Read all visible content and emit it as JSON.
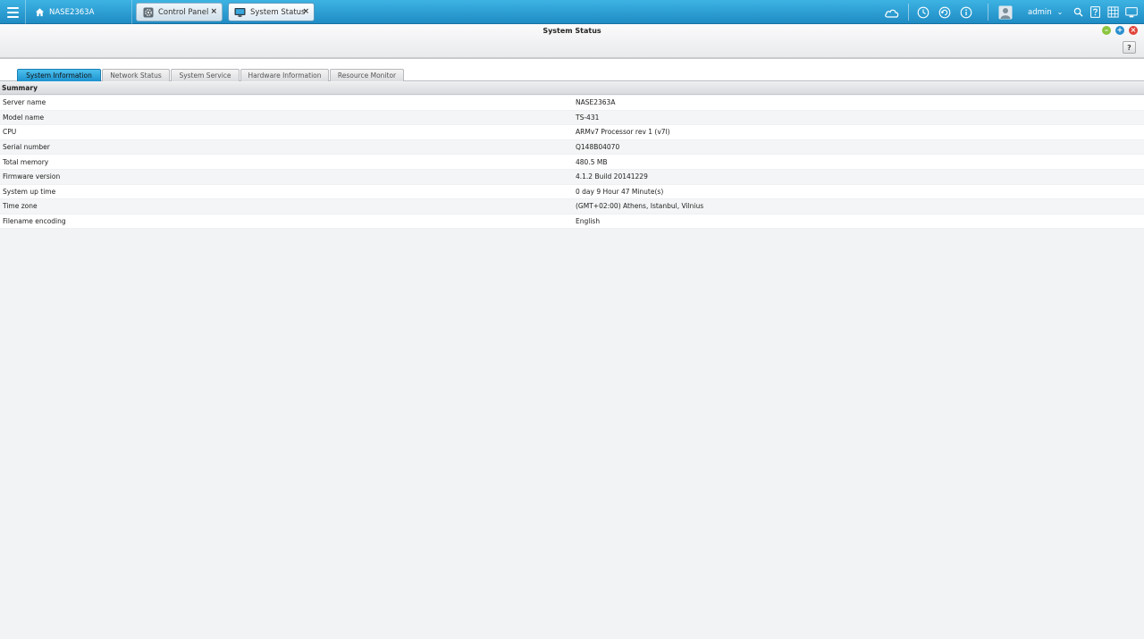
{
  "taskbar": {
    "home_label": "NASE2363A",
    "tabs": [
      {
        "label": "Control Panel",
        "close": "×"
      },
      {
        "label": "System Status",
        "close": "×"
      }
    ],
    "user": {
      "name": "admin",
      "caret": "⌄"
    }
  },
  "window": {
    "title": "System Status",
    "help": "?",
    "controls": {
      "minimize": "–",
      "maximize": "+",
      "close": "×"
    }
  },
  "subtabs": [
    {
      "label": "System Information",
      "active": true
    },
    {
      "label": "Network Status",
      "active": false
    },
    {
      "label": "System Service",
      "active": false
    },
    {
      "label": "Hardware Information",
      "active": false
    },
    {
      "label": "Resource Monitor",
      "active": false
    }
  ],
  "summary": {
    "header": "Summary",
    "rows": [
      {
        "key": "Server name",
        "value": "NASE2363A"
      },
      {
        "key": "Model name",
        "value": "TS-431"
      },
      {
        "key": "CPU",
        "value": "ARMv7 Processor rev 1 (v7l)"
      },
      {
        "key": "Serial number",
        "value": "Q148B04070"
      },
      {
        "key": "Total memory",
        "value": "480.5 MB"
      },
      {
        "key": "Firmware version",
        "value": "4.1.2 Build 20141229"
      },
      {
        "key": "System up time",
        "value": "0 day 9 Hour 47 Minute(s)"
      },
      {
        "key": "Time zone",
        "value": "(GMT+02:00) Athens, Istanbul, Vilnius"
      },
      {
        "key": "Filename encoding",
        "value": "English"
      }
    ]
  },
  "colors": {
    "taskbar": "#2aa0d6",
    "active_subtab": "#1d93cf",
    "minimize": "#8cc63f",
    "maximize": "#2a8fd0",
    "close": "#e0443a"
  }
}
